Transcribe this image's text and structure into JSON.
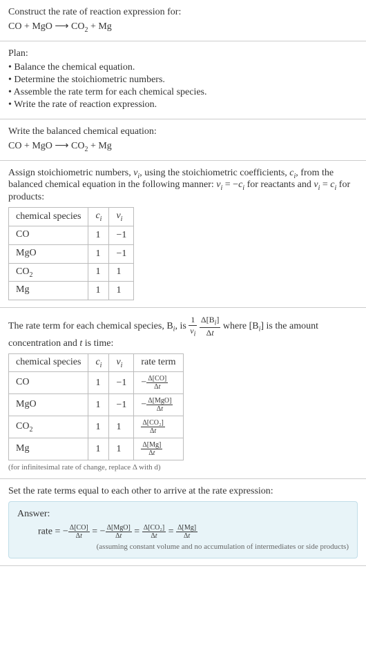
{
  "header": {
    "title": "Construct the rate of reaction expression for:",
    "equation_lhs": "CO + MgO",
    "equation_rhs": "CO",
    "equation_rhs_sub": "2",
    "equation_rhs2": " + Mg"
  },
  "plan": {
    "title": "Plan:",
    "items": [
      "• Balance the chemical equation.",
      "• Determine the stoichiometric numbers.",
      "• Assemble the rate term for each chemical species.",
      "• Write the rate of reaction expression."
    ]
  },
  "balanced": {
    "title": "Write the balanced chemical equation:",
    "equation_lhs": "CO + MgO",
    "equation_rhs": "CO",
    "equation_rhs_sub": "2",
    "equation_rhs2": " + Mg"
  },
  "stoich": {
    "intro1": "Assign stoichiometric numbers, ",
    "nu": "ν",
    "i": "i",
    "intro2": ", using the stoichiometric coefficients, ",
    "c": "c",
    "intro3": ", from the balanced chemical equation in the following manner: ",
    "eq1_lhs": "ν",
    "eq1_mid": " = −",
    "eq1_rhs": "c",
    "intro4": " for reactants and ",
    "eq2_mid": " = ",
    "intro5": " for products:",
    "headers": [
      "chemical species",
      "cᵢ",
      "νᵢ"
    ],
    "rows": [
      {
        "species": "CO",
        "sub": "",
        "c": "1",
        "nu": "−1"
      },
      {
        "species": "MgO",
        "sub": "",
        "c": "1",
        "nu": "−1"
      },
      {
        "species": "CO",
        "sub": "2",
        "c": "1",
        "nu": "1"
      },
      {
        "species": "Mg",
        "sub": "",
        "c": "1",
        "nu": "1"
      }
    ]
  },
  "rateterm": {
    "intro1": "The rate term for each chemical species, B",
    "intro2": ", is ",
    "frac1_num": "1",
    "frac1_den_nu": "ν",
    "frac2_num": "Δ[B",
    "frac2_num2": "]",
    "frac2_den": "Δt",
    "intro3": " where [B",
    "intro4": "] is the amount concentration and ",
    "t": "t",
    "intro5": " is time:",
    "headers": [
      "chemical species",
      "cᵢ",
      "νᵢ",
      "rate term"
    ],
    "rows": [
      {
        "species": "CO",
        "sub": "",
        "c": "1",
        "nu": "−1",
        "sign": "−",
        "num": "Δ[CO]",
        "den": "Δt"
      },
      {
        "species": "MgO",
        "sub": "",
        "c": "1",
        "nu": "−1",
        "sign": "−",
        "num": "Δ[MgO]",
        "den": "Δt"
      },
      {
        "species": "CO",
        "sub": "2",
        "c": "1",
        "nu": "1",
        "sign": "",
        "num": "Δ[CO₂]",
        "den": "Δt"
      },
      {
        "species": "Mg",
        "sub": "",
        "c": "1",
        "nu": "1",
        "sign": "",
        "num": "Δ[Mg]",
        "den": "Δt"
      }
    ],
    "note": "(for infinitesimal rate of change, replace Δ with d)"
  },
  "final": {
    "title": "Set the rate terms equal to each other to arrive at the rate expression:",
    "answer_label": "Answer:",
    "rate_label": "rate = ",
    "terms": [
      {
        "sign": "−",
        "num": "Δ[CO]",
        "den": "Δt"
      },
      {
        "sign": "−",
        "num": "Δ[MgO]",
        "den": "Δt"
      },
      {
        "sign": "",
        "num": "Δ[CO₂]",
        "den": "Δt"
      },
      {
        "sign": "",
        "num": "Δ[Mg]",
        "den": "Δt"
      }
    ],
    "eq": " = ",
    "note": "(assuming constant volume and no accumulation of intermediates or side products)"
  },
  "chart_data": {
    "type": "table",
    "tables": [
      {
        "title": "Stoichiometric numbers",
        "headers": [
          "chemical species",
          "c_i",
          "ν_i"
        ],
        "rows": [
          [
            "CO",
            1,
            -1
          ],
          [
            "MgO",
            1,
            -1
          ],
          [
            "CO2",
            1,
            1
          ],
          [
            "Mg",
            1,
            1
          ]
        ]
      },
      {
        "title": "Rate terms",
        "headers": [
          "chemical species",
          "c_i",
          "ν_i",
          "rate term"
        ],
        "rows": [
          [
            "CO",
            1,
            -1,
            "-Δ[CO]/Δt"
          ],
          [
            "MgO",
            1,
            -1,
            "-Δ[MgO]/Δt"
          ],
          [
            "CO2",
            1,
            1,
            "Δ[CO2]/Δt"
          ],
          [
            "Mg",
            1,
            1,
            "Δ[Mg]/Δt"
          ]
        ]
      }
    ]
  }
}
